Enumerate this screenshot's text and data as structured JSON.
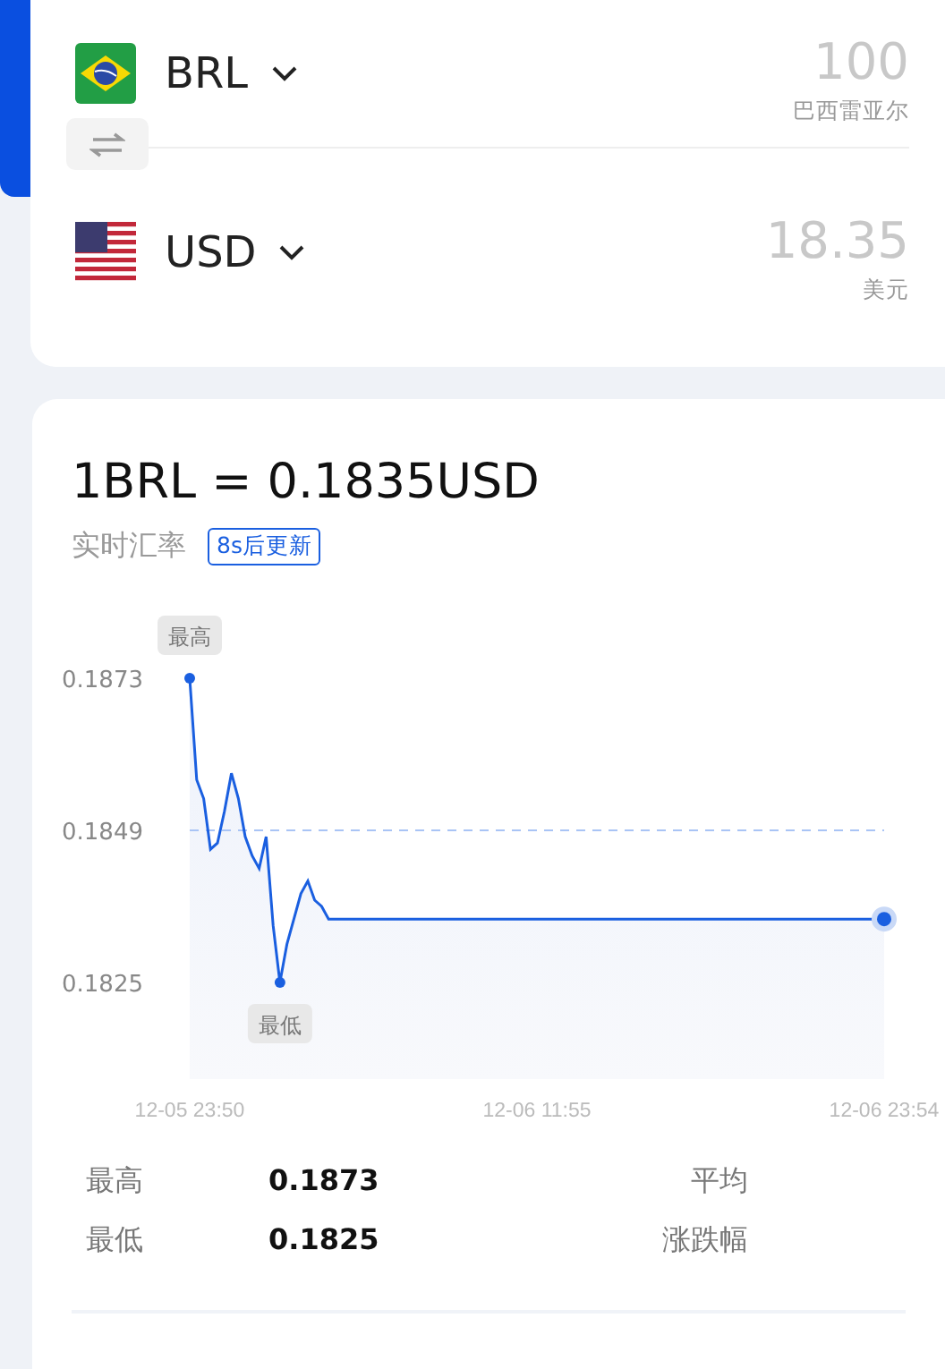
{
  "converter": [
    {
      "kind": "brazil",
      "code": "BRL",
      "amount": "100",
      "name": "巴西雷亚尔"
    },
    {
      "kind": "usa",
      "code": "USD",
      "amount": "18.35",
      "name": "美元"
    }
  ],
  "rate": {
    "title": "1BRL = 0.1835USD",
    "label": "实时汇率",
    "badge": "8s后更新"
  },
  "chart_data": {
    "type": "area",
    "categories": [
      "12-05 23:50",
      null,
      null,
      null,
      null,
      null,
      null,
      null,
      null,
      null,
      null,
      null,
      null,
      null,
      null,
      null,
      null,
      null,
      null,
      null,
      null,
      null,
      null,
      null,
      null,
      null,
      null,
      null,
      null,
      null,
      null,
      null,
      null,
      null,
      null,
      null,
      null,
      null,
      null,
      null,
      null,
      null,
      null,
      null,
      null,
      null,
      null,
      null,
      null,
      null,
      "12-06 11:55",
      null,
      null,
      null,
      null,
      null,
      null,
      null,
      null,
      null,
      null,
      null,
      null,
      null,
      null,
      null,
      null,
      null,
      null,
      null,
      null,
      null,
      null,
      null,
      null,
      null,
      null,
      null,
      null,
      null,
      null,
      null,
      null,
      null,
      null,
      null,
      null,
      null,
      null,
      null,
      null,
      null,
      null,
      null,
      null,
      null,
      null,
      null,
      null,
      null,
      "12-06 23:54"
    ],
    "series": [
      {
        "color": "#1a5fe0",
        "values": [
          0.1873,
          0.1857,
          0.1854,
          0.1846,
          0.1847,
          0.1852,
          0.1858,
          0.1854,
          0.1848,
          0.1845,
          0.1843,
          0.1848,
          0.1834,
          0.1825,
          0.1831,
          0.1835,
          0.1839,
          0.1841,
          0.1838,
          0.1837,
          0.1835,
          0.1835,
          0.1835,
          0.1835,
          0.1835,
          0.1835,
          0.1835,
          0.1835,
          0.1835,
          0.1835,
          0.1835,
          0.1835,
          0.1835,
          0.1835,
          0.1835,
          0.1835,
          0.1835,
          0.1835,
          0.1835,
          0.1835,
          0.1835,
          0.1835,
          0.1835,
          0.1835,
          0.1835,
          0.1835,
          0.1835,
          0.1835,
          0.1835,
          0.1835,
          0.1835,
          0.1835,
          0.1835,
          0.1835,
          0.1835,
          0.1835,
          0.1835,
          0.1835,
          0.1835,
          0.1835,
          0.1835,
          0.1835,
          0.1835,
          0.1835,
          0.1835,
          0.1835,
          0.1835,
          0.1835,
          0.1835,
          0.1835,
          0.1835,
          0.1835,
          0.1835,
          0.1835,
          0.1835,
          0.1835,
          0.1835,
          0.1835,
          0.1835,
          0.1835,
          0.1835,
          0.1835,
          0.1835,
          0.1835,
          0.1835,
          0.1835,
          0.1835,
          0.1835,
          0.1835,
          0.1835,
          0.1835,
          0.1835,
          0.1835,
          0.1835,
          0.1835,
          0.1835,
          0.1835,
          0.1835,
          0.1835,
          0.1835,
          0.1835
        ]
      }
    ],
    "ylim": [
      0.1825,
      0.1873
    ],
    "ref_lines": [
      {
        "axis": "y",
        "value": 0.1849
      }
    ],
    "yticks": [
      0.1873,
      0.1849,
      0.1825
    ],
    "annotations": [
      {
        "text": "最高",
        "y": 0.1873
      },
      {
        "text": "最低",
        "y": 0.1825
      }
    ]
  },
  "stats": [
    {
      "label": "最高",
      "value": "0.1873"
    },
    {
      "label": "平均"
    },
    {
      "label": "最低",
      "value": "0.1825"
    },
    {
      "label": "涨跌幅"
    }
  ]
}
